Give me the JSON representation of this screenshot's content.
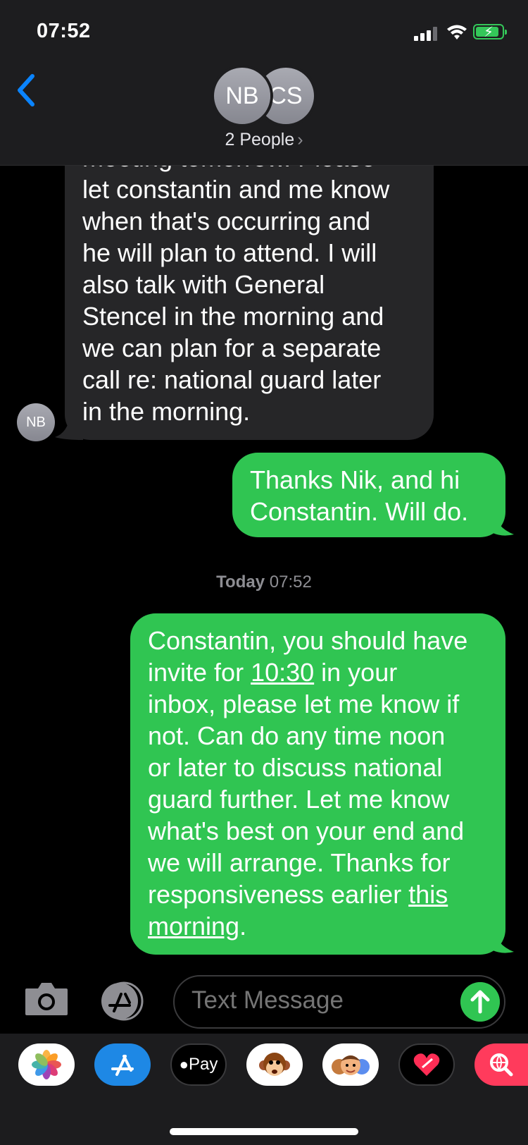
{
  "status_bar": {
    "time": "07:52"
  },
  "header": {
    "avatars": [
      "NB",
      "CS"
    ],
    "people_label": "2 People",
    "chevron": "›"
  },
  "messages": [
    {
      "sender": "NB",
      "direction": "incoming",
      "lines": [
        "meeting tomorrow. Please",
        "let constantin and me know",
        "when that's occurring and",
        "he will plan to attend. I will",
        "also talk with General",
        "Stencel in the morning and",
        "we can plan for a separate",
        "call re: national guard later",
        "in the morning."
      ]
    },
    {
      "direction": "outgoing",
      "lines": [
        "Thanks Nik, and hi",
        "Constantin. Will do."
      ]
    },
    {
      "direction": "outgoing",
      "parts": {
        "l1": "Constantin, you should have",
        "l2_pre": "invite for ",
        "l2_link": "10:30",
        "l2_post": " in your",
        "l3": "inbox, please let me know if",
        "l4": "not. Can do any time noon",
        "l5": "or later to discuss national",
        "l6": "guard further. Let me know",
        "l7": "what's best on your end and",
        "l8": "we will arrange. Thanks for",
        "l9_pre": "responsiveness earlier ",
        "l9_link": "this",
        "l10_link": "morning",
        "l10_post": "."
      }
    }
  ],
  "timestamp": {
    "day": "Today",
    "time": "07:52"
  },
  "composer": {
    "placeholder": "Text Message"
  },
  "app_drawer": {
    "items": [
      "photos-icon",
      "app-store-icon",
      "apple-pay-icon",
      "animoji-monkey-icon",
      "memoji-icon",
      "digital-touch-icon",
      "image-search-icon"
    ],
    "apple_pay_label": "Pay"
  },
  "colors": {
    "outgoing": "#30c552",
    "incoming": "#262628",
    "link_blue": "#0a84ff"
  }
}
